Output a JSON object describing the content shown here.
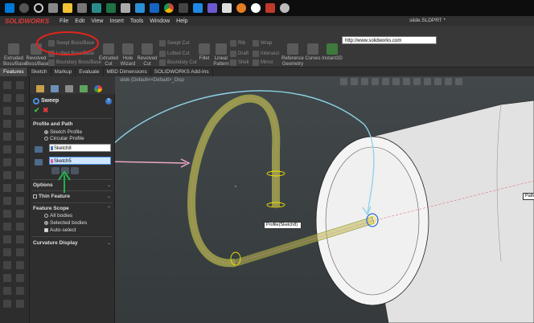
{
  "app": {
    "brand": "SOLIDWORKS",
    "document_title": "slide.SLDPRT *",
    "menu": [
      "File",
      "Edit",
      "View",
      "Insert",
      "Tools",
      "Window",
      "Help"
    ],
    "url": "http://www.solidworks.com"
  },
  "ribbon": {
    "extruded_boss": "Extruded Boss/Base",
    "revolved_boss": "Revolved Boss/Base",
    "swept_boss": "Swept Boss/Base",
    "lofted_boss": "Lofted Boss/Base",
    "boundary_boss": "Boundary Boss/Base",
    "extruded_cut": "Extruded Cut",
    "hole_wizard": "Hole Wizard",
    "revolved_cut": "Revolved Cut",
    "swept_cut": "Swept Cut",
    "lofted_cut": "Lofted Cut",
    "boundary_cut": "Boundary Cut",
    "fillet": "Fillet",
    "linear_pattern": "Linear Pattern",
    "rib": "Rib",
    "draft": "Draft",
    "shell": "Shell",
    "wrap": "Wrap",
    "intersect": "Intersect",
    "mirror": "Mirror",
    "reference_geometry": "Reference Geometry",
    "curves": "Curves",
    "instant3d": "Instant3D"
  },
  "cm_tabs": [
    "Features",
    "Sketch",
    "Markup",
    "Evaluate",
    "MBD Dimensions",
    "SOLIDWORKS Add-Ins"
  ],
  "cm_tab_active": 0,
  "graphics": {
    "breadcrumb": "slide (Default<<Default>_Disp",
    "profile_tag": "Profile(Sketch8)",
    "path_tag": "Path"
  },
  "pm": {
    "title": "Sweep",
    "help": "?",
    "ok": "✔",
    "cancel": "✖",
    "profile_and_path": "Profile and Path",
    "sketch_profile": "Sketch Profile",
    "circular_profile": "Circular Profile",
    "profile_value": "Sketch8",
    "path_value": "Sketch5",
    "options": "Options",
    "thin_feature": "Thin Feature",
    "feature_scope": "Feature Scope",
    "all_bodies": "All bodies",
    "selected_bodies": "Selected bodies",
    "auto_select": "Auto-select",
    "curvature_display": "Curvature Display"
  },
  "colors": {
    "accent_red": "#e03a3a",
    "annotation_red": "#e0241f",
    "annotation_blue": "#8fd3ea",
    "annotation_pink": "#f4a9c8",
    "annotation_green": "#22b14c",
    "sweep_preview": "#b9bc4e"
  }
}
